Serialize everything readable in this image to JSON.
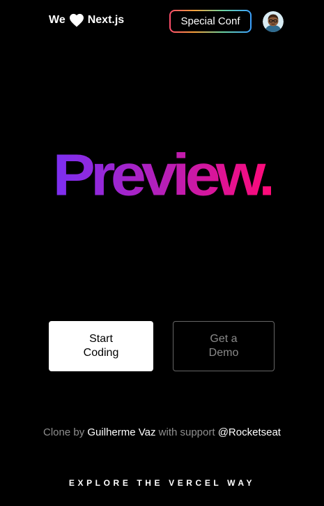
{
  "header": {
    "brand_left": "We",
    "brand_right": "Next.js",
    "heart_icon": "heart-icon",
    "conf_button_label": "Special Conf",
    "avatar_icon": "user-avatar"
  },
  "hero": {
    "title": "Preview."
  },
  "actions": {
    "primary_label": "Start Coding",
    "secondary_label": "Get a Demo"
  },
  "credits": {
    "prefix": "Clone by",
    "author": "Guilherme Vaz",
    "middle": "with support",
    "handle": "@Rocketseat"
  },
  "footer": {
    "text": "EXPLORE THE VERCEL WAY"
  },
  "colors": {
    "background": "#000000",
    "gradient_start": "#7b2ff2",
    "gradient_end": "#ff0a78"
  }
}
